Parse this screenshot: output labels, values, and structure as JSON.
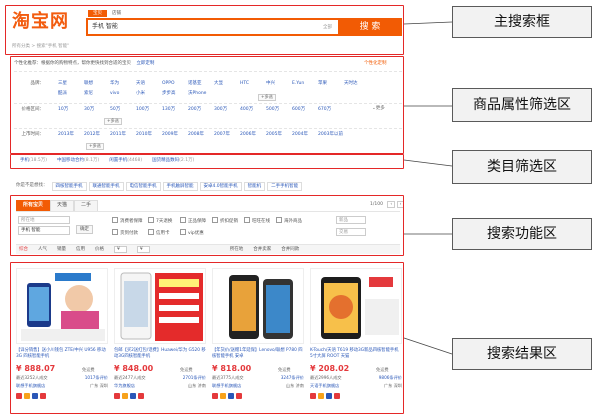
{
  "header": {
    "logo": "淘宝网",
    "tabs": [
      "宝贝",
      "店铺"
    ],
    "query": "手机 智能",
    "scope": "全部",
    "search_button": "搜 索",
    "crumbs": "所有分类 > 搜索\"手机 智能\""
  },
  "attributes": {
    "tip": "个性化推荐：根据你的购物特点，帮你更快找到合适的宝贝",
    "tip_link": "立即定制",
    "custom_link": "个性化定制",
    "rows": [
      {
        "label": "品牌：",
        "values": [
          "三星",
          "联想",
          "华为",
          "天语",
          "OPPO",
          "诺基亚",
          "大显",
          "HTC",
          "中兴",
          "E.Yun",
          "苹果",
          "天时达",
          "酷派",
          "索尼",
          "vivo",
          "小米",
          "步步高",
          "沃Phone"
        ],
        "more": "+多选"
      },
      {
        "label": "价格区间：",
        "values": [
          "10万",
          "30万",
          "50万",
          "100万",
          "130万",
          "200万",
          "300万",
          "400万",
          "500万",
          "600万",
          "670万"
        ],
        "more": "+多选",
        "extra": "更多"
      },
      {
        "label": "上市时间：",
        "values": [
          "2013年",
          "2012年",
          "2011年",
          "2010年",
          "2009年",
          "2008年",
          "2007年",
          "2006年",
          "2005年",
          "2004年",
          "2003年以前"
        ],
        "more": "+多选"
      }
    ]
  },
  "categories": [
    {
      "name": "手机",
      "count": "(18.5万)"
    },
    {
      "name": "中国移动合约",
      "count": "(8.1万)"
    },
    {
      "name": "闲置手机",
      "count": "(4468)"
    },
    {
      "name": "国货精品数码",
      "count": "(2.1万)"
    }
  ],
  "recommend": {
    "label": "你是不是想找：",
    "items": [
      "四核智能手机",
      "联通智能手机",
      "电信智能手机",
      "手机触屏智能",
      "安卓4.0智能手机",
      "智能机",
      "二手手机智能"
    ]
  },
  "functions": {
    "tabs": [
      "所有宝贝",
      "天猫",
      "二手"
    ],
    "page": "1/100",
    "filters": [
      "消费者保障",
      "7天退换",
      "正品保障",
      "折扣促销",
      "旺旺在线",
      "海外商品",
      "货到付款",
      "信用卡",
      "vip优惠"
    ],
    "location_placeholder": "所在地",
    "keyword": "手机 智能",
    "confirm": "确定",
    "sort": [
      "综合",
      "人气",
      "销量",
      "信用",
      "价格"
    ],
    "price_from": "¥",
    "price_to": "¥",
    "right_opts": [
      "所在地",
      "合并卖家",
      "合并同款",
      "新品",
      "交易"
    ]
  },
  "products": [
    {
      "title": "【详分销售】送小川钱包 ZTE/中兴 U956 移动3G 四核智能手机",
      "price": "¥ 888.07",
      "free": "免运费",
      "sales": "最近3252人成交",
      "reviews": "1017条评价",
      "shop": "联想手机旗舰店",
      "loc": "广东 深圳"
    },
    {
      "title": "包邮【买2送红包/话费】Huawei/华为 G520 移动3G四核智能手机",
      "price": "¥ 848.00",
      "free": "免运费",
      "sales": "最近2477人成交",
      "reviews": "2701条评价",
      "shop": "华为旗舰店",
      "loc": "山东 济南"
    },
    {
      "title": "【年货价/送赠1年延保】Lenovo/联想 P780 四核智能手机 安卓",
      "price": "¥ 818.00",
      "free": "免运费",
      "sales": "最近3775人成交",
      "reviews": "3247条评价",
      "shop": "联想手机旗舰店",
      "loc": "山东 济南"
    },
    {
      "title": "K-Touch/天语 T619 移动3G新品四核智能手机 5寸大屏 ROOT 天猫",
      "price": "¥ 208.02",
      "free": "免运费",
      "sales": "最近2996人成交",
      "reviews": "9806条评价",
      "shop": "天语手机旗舰店",
      "loc": "广东 深圳"
    }
  ],
  "labels": [
    "主搜索框",
    "商品属性筛选区",
    "类目筛选区",
    "搜索功能区",
    "搜索结果区"
  ]
}
